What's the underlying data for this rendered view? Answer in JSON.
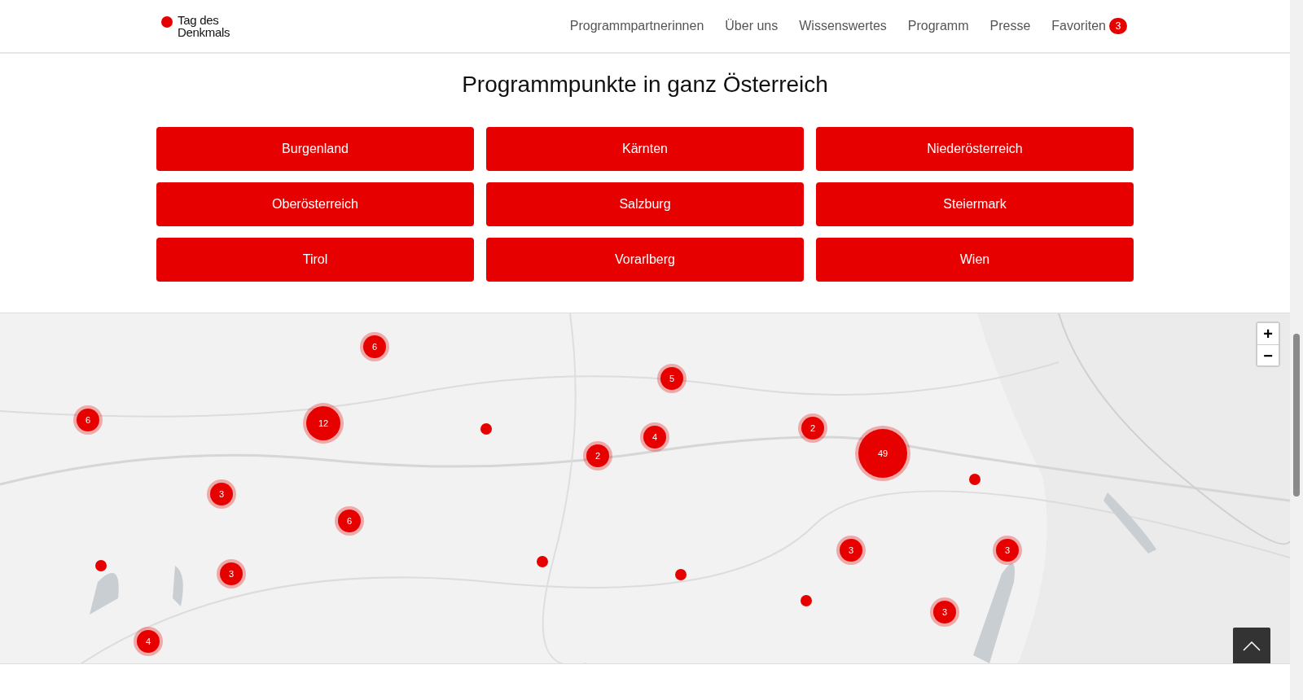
{
  "header": {
    "logo": [
      "Tag des",
      "Denkmals"
    ],
    "nav": [
      {
        "label": "Programmpartnerinnen"
      },
      {
        "label": "Über uns"
      },
      {
        "label": "Wissenswertes"
      },
      {
        "label": "Programm"
      },
      {
        "label": "Presse"
      },
      {
        "label": "Favoriten",
        "badge": "3"
      }
    ]
  },
  "title": "Programmpunkte in ganz Österreich",
  "regions": [
    "Burgenland",
    "Kärnten",
    "Niederösterreich",
    "Oberösterreich",
    "Salzburg",
    "Steiermark",
    "Tirol",
    "Vorarlberg",
    "Wien"
  ],
  "map": {
    "kind": "picture",
    "zoom": [
      "+",
      "−"
    ],
    "markers": [
      {
        "kind": "cluster",
        "count": "6"
      },
      {
        "kind": "cluster",
        "count": "6"
      },
      {
        "kind": "cluster",
        "count": "12"
      },
      {
        "kind": "dot"
      },
      {
        "kind": "cluster",
        "count": "5"
      },
      {
        "kind": "cluster",
        "count": "4"
      },
      {
        "kind": "cluster",
        "count": "2"
      },
      {
        "kind": "cluster",
        "count": "2"
      },
      {
        "kind": "cluster",
        "count": "49"
      },
      {
        "kind": "dot"
      },
      {
        "kind": "cluster",
        "count": "3"
      },
      {
        "kind": "cluster",
        "count": "6"
      },
      {
        "kind": "cluster",
        "count": "3"
      },
      {
        "kind": "cluster",
        "count": "3"
      },
      {
        "kind": "dot"
      },
      {
        "kind": "cluster",
        "count": "3"
      },
      {
        "kind": "dot"
      },
      {
        "kind": "dot"
      },
      {
        "kind": "dot"
      },
      {
        "kind": "cluster",
        "count": "3"
      },
      {
        "kind": "cluster",
        "count": "4"
      }
    ]
  }
}
